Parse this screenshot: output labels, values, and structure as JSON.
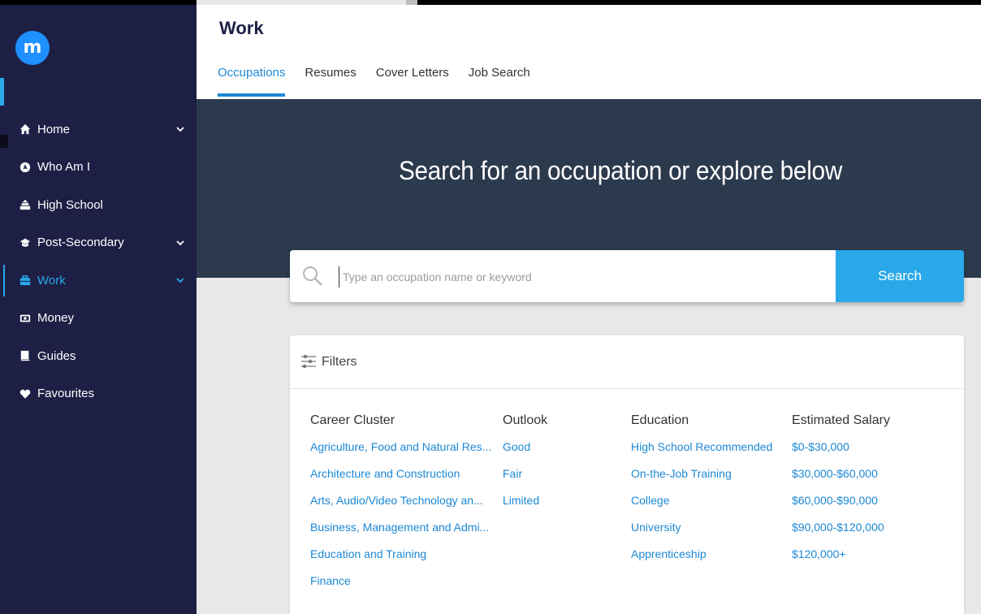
{
  "page": {
    "title": "Work"
  },
  "tabs": [
    {
      "label": "Occupations"
    },
    {
      "label": "Resumes"
    },
    {
      "label": "Cover Letters"
    },
    {
      "label": "Job Search"
    }
  ],
  "sidebar": {
    "logo_letter": "m",
    "items": [
      {
        "label": "Home",
        "icon": "home-icon"
      },
      {
        "label": "Who Am I",
        "icon": "compass-icon"
      },
      {
        "label": "High School",
        "icon": "school-icon"
      },
      {
        "label": "Post-Secondary",
        "icon": "graduation-cap-icon"
      },
      {
        "label": "Work",
        "icon": "briefcase-icon"
      },
      {
        "label": "Money",
        "icon": "money-icon"
      },
      {
        "label": "Guides",
        "icon": "book-icon"
      },
      {
        "label": "Favourites",
        "icon": "heart-icon"
      }
    ]
  },
  "hero": {
    "title": "Search for an occupation or explore below"
  },
  "search": {
    "placeholder": "Type an occupation name or keyword",
    "button_label": "Search"
  },
  "filters": {
    "label": "Filters",
    "career_cluster": {
      "title": "Career Cluster",
      "items": [
        "Agriculture, Food and Natural Res...",
        "Architecture and Construction",
        "Arts, Audio/Video Technology an...",
        "Business, Management and Admi...",
        "Education and Training",
        "Finance"
      ]
    },
    "outlook": {
      "title": "Outlook",
      "items": [
        "Good",
        "Fair",
        "Limited"
      ]
    },
    "education": {
      "title": "Education",
      "items": [
        "High School Recommended",
        "On-the-Job Training",
        "College",
        "University",
        "Apprenticeship"
      ]
    },
    "salary": {
      "title": "Estimated Salary",
      "items": [
        "$0-$30,000",
        "$30,000-$60,000",
        "$60,000-$90,000",
        "$90,000-$120,000",
        "$120,000+"
      ]
    }
  },
  "colors": {
    "sidebar": "#1e1f45",
    "accent": "#29a8ea",
    "link": "#1b88d4",
    "hero": "#2c3a4e"
  }
}
